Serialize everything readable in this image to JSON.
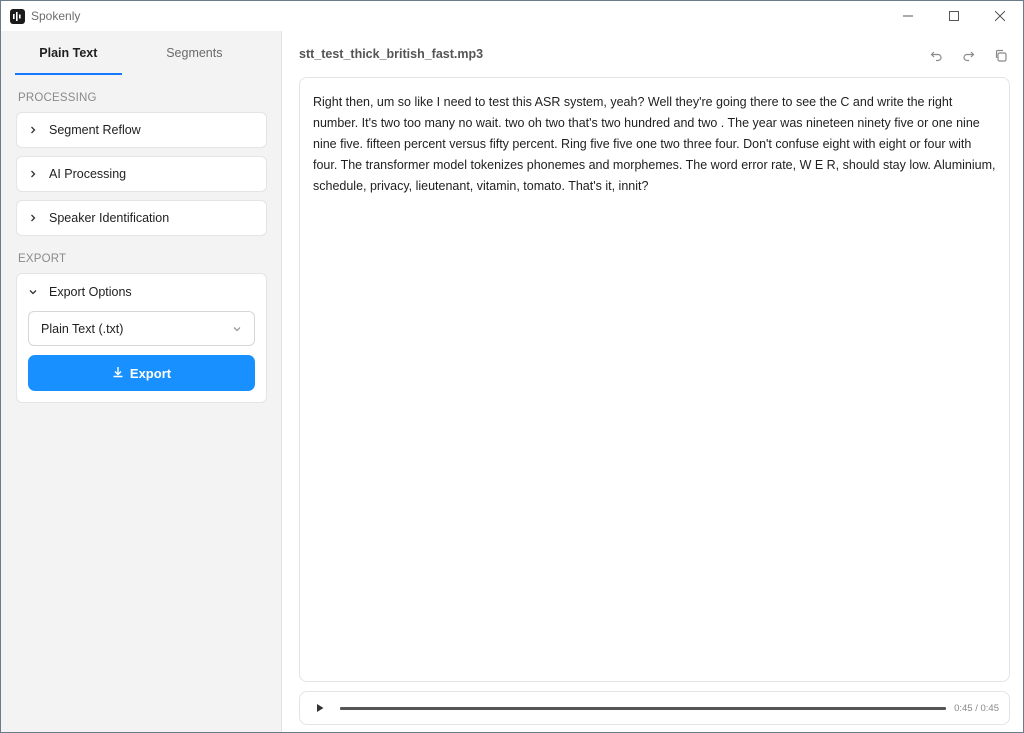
{
  "window": {
    "app_title": "Spokenly",
    "app_icon": "waveform-logo-icon",
    "controls": [
      "minimize-icon",
      "maximize-icon",
      "close-icon"
    ]
  },
  "sidebar": {
    "tabs": [
      {
        "label": "Plain Text",
        "active": true
      },
      {
        "label": "Segments",
        "active": false
      }
    ],
    "processing_label": "PROCESSING",
    "processing_items": [
      {
        "label": "Segment Reflow"
      },
      {
        "label": "AI Processing"
      },
      {
        "label": "Speaker Identification"
      }
    ],
    "export_label": "EXPORT",
    "export_options": {
      "label": "Export Options",
      "format_selected": "Plain Text (.txt)",
      "button_label": "Export"
    }
  },
  "main": {
    "file_name": "stt_test_thick_british_fast.mp3",
    "toolbar": [
      "undo-icon",
      "redo-icon",
      "copy-icon"
    ],
    "transcript": "Right then, um so like I need to test this ASR system, yeah? Well they're going there to see the C and write the right number. It's two too many no wait. two oh two that's two hundred and two . The year was nineteen ninety five or one nine nine five. fifteen percent versus fifty percent. Ring five five one two three four. Don't confuse eight with eight or four with four. The transformer model tokenizes phonemes and morphemes. The word error rate, W E R, should stay low. Aluminium, schedule, privacy, lieutenant, vitamin, tomato. That's it, innit?",
    "player": {
      "time": "0:45 / 0:45",
      "progress": 1.0
    }
  },
  "colors": {
    "accent": "#1890ff",
    "tab_underline": "#1677ff"
  }
}
